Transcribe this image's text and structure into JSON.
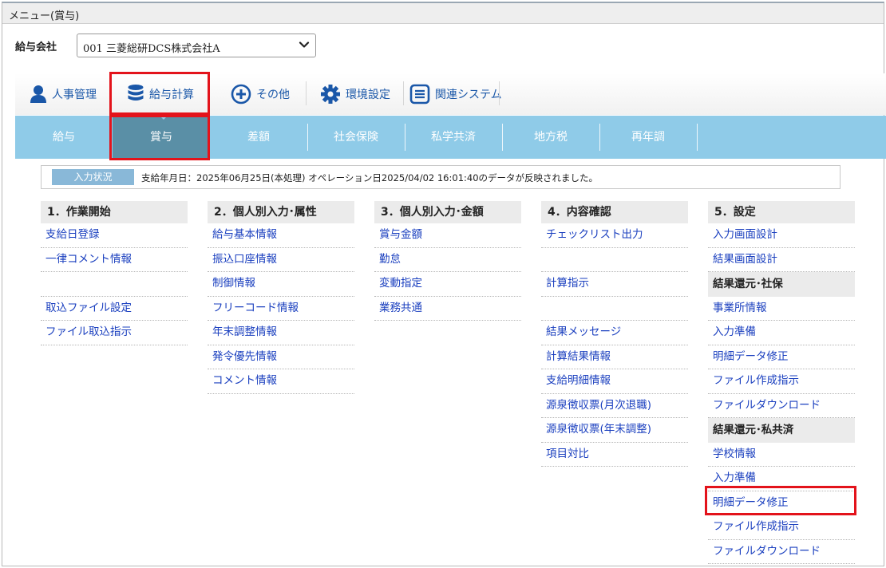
{
  "window": {
    "title": "メニュー(賞与)"
  },
  "company": {
    "label": "給与会社",
    "selected": "001 三菱総研DCS株式会社A"
  },
  "topnav": [
    {
      "label": "人事管理",
      "icon": "person-icon"
    },
    {
      "label": "給与計算",
      "icon": "database-icon"
    },
    {
      "label": "その他",
      "icon": "plus-circle-icon"
    },
    {
      "label": "環境設定",
      "icon": "gear-icon"
    },
    {
      "label": "関連システム",
      "icon": "list-box-icon"
    }
  ],
  "subnav": [
    "給与",
    "賞与",
    "差額",
    "社会保険",
    "私学共済",
    "地方税",
    "再年調"
  ],
  "status": {
    "badge": "入力状況",
    "message": "支給年月日：2025年06月25日(本処理) オペレーション日2025/04/02 16:01:40のデータが反映されました。"
  },
  "columns": [
    {
      "title": "1．作業開始",
      "items": [
        "支給日登録",
        "一律コメント情報",
        "",
        "取込ファイル設定",
        "ファイル取込指示"
      ]
    },
    {
      "title": "2．個人別入力･属性",
      "items": [
        "給与基本情報",
        "振込口座情報",
        "制御情報",
        "フリーコード情報",
        "年末調整情報",
        "発令優先情報",
        "コメント情報"
      ]
    },
    {
      "title": "3．個人別入力･金額",
      "items": [
        "賞与金額",
        "勤怠",
        "変動指定",
        "業務共通"
      ]
    },
    {
      "title": "4．内容確認",
      "items": [
        "チェックリスト出力",
        "",
        "計算指示",
        "",
        "結果メッセージ",
        "計算結果情報",
        "支給明細情報",
        "源泉徴収票(月次退職)",
        "源泉徴収票(年末調整)",
        "項目対比"
      ]
    },
    {
      "title": "5．設定",
      "items": [
        "入力画面設計",
        "結果画面設計"
      ],
      "sections": [
        {
          "title": "結果還元･社保",
          "items": [
            "事業所情報",
            "入力準備",
            "明細データ修正",
            "ファイル作成指示",
            "ファイルダウンロード"
          ]
        },
        {
          "title": "結果還元･私共済",
          "items": [
            "学校情報",
            "入力準備",
            "明細データ修正",
            "ファイル作成指示",
            "ファイルダウンロード"
          ]
        }
      ]
    }
  ],
  "colors": {
    "link": "#1a3fbf",
    "subnav_bg": "#8fcbe8",
    "subnav_active": "#5a8fa6",
    "highlight": "#e3131b"
  }
}
